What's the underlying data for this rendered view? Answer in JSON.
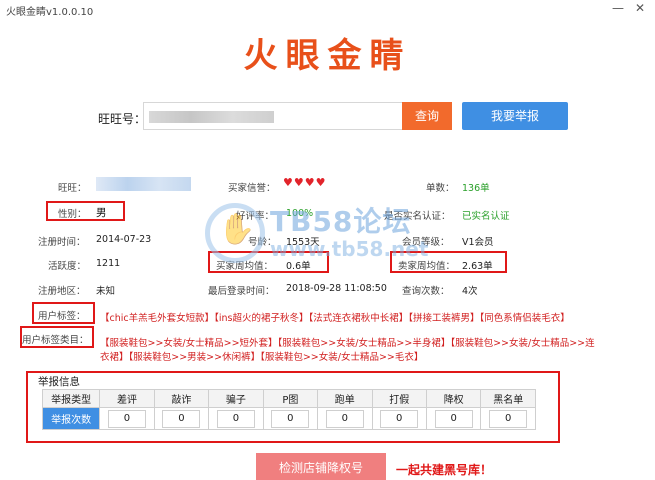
{
  "window": {
    "title": "火眼金睛v1.0.0.10",
    "minimize": "—",
    "close": "✕"
  },
  "logo": "火眼金睛",
  "search": {
    "label": "旺旺号：",
    "query_button": "查询",
    "report_button": "我要举报"
  },
  "info": {
    "wangwang_label": "旺旺：",
    "buyer_credit_label": "买家信誉：",
    "buyer_credit_hearts": "♥♥♥♥",
    "order_count_label": "单数：",
    "order_count_value": "136单",
    "gender_label": "性别：",
    "gender_value": "男",
    "good_rate_label": "好评率：",
    "good_rate_value": "100%",
    "realname_label": "是否实名认证：",
    "realname_value": "已实名认证",
    "register_time_label": "注册时间：",
    "register_time_value": "2014-07-23",
    "age_label": "号龄：",
    "age_value": "1553天",
    "member_level_label": "会员等级：",
    "member_level_value": "V1会员",
    "activity_label": "活跃度：",
    "activity_value": "1211",
    "buyer_weekly_label": "买家周均值：",
    "buyer_weekly_value": "0.6单",
    "seller_weekly_label": "卖家周均值：",
    "seller_weekly_value": "2.63单",
    "region_label": "注册地区：",
    "region_value": "未知",
    "last_login_label": "最后登录时间：",
    "last_login_value": "2018-09-28 11:08:50",
    "query_count_label": "查询次数：",
    "query_count_value": "4次"
  },
  "tags": {
    "label": "用户标签：",
    "line": "【chic羊羔毛外套女短款】【ins超火的裙子秋冬】【法式连衣裙秋中长裙】【拼接工装裤男】【同色系情侣装毛衣】"
  },
  "categories": {
    "label": "用户标签类目：",
    "line1": "【服装鞋包>>女装/女士精品>>短外套】【服装鞋包>>女装/女士精品>>半身裙】【服装鞋包>>女装/女士精品>>连",
    "line2": "衣裙】【服装鞋包>>男装>>休闲裤】【服装鞋包>>女装/女士精品>>毛衣】"
  },
  "watermark": {
    "title": "TB58论坛",
    "url": "www.tb58.net"
  },
  "report": {
    "title": "举报信息",
    "headers": [
      "举报类型",
      "差评",
      "敲诈",
      "骗子",
      "P图",
      "跑单",
      "打假",
      "降权",
      "黑名单"
    ],
    "row_label": "举报次数",
    "values": [
      "0",
      "0",
      "0",
      "0",
      "0",
      "0",
      "0",
      "0"
    ]
  },
  "footer": {
    "detect_button": "检测店铺降权号",
    "slogan": "一起共建黑号库！"
  },
  "colors": {
    "accent_orange": "#f26a2c",
    "accent_blue": "#3f8fe3",
    "highlight_red": "#e01818",
    "green": "#2aa02a"
  }
}
